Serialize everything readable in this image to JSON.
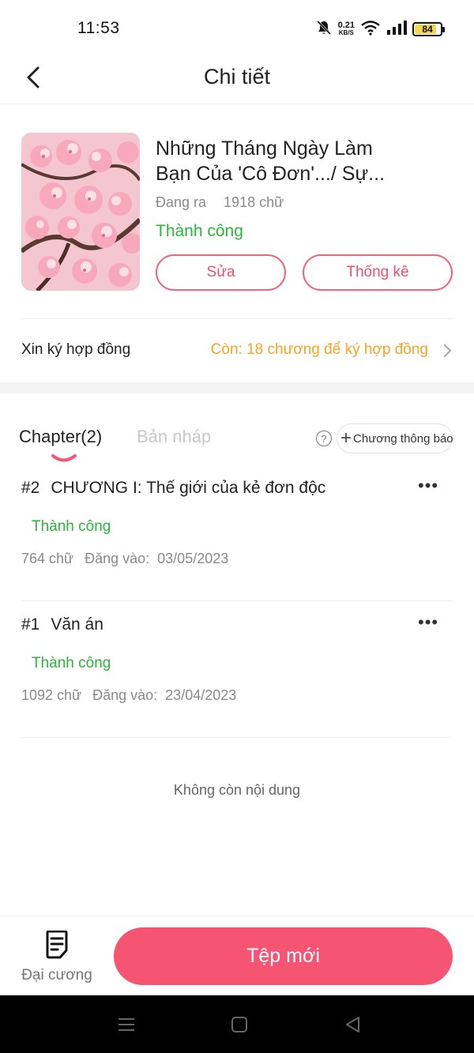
{
  "status_bar": {
    "time": "11:53",
    "net_speed": "0.21",
    "net_unit": "KB/S",
    "battery": "84",
    "battery_fraction": 0.84
  },
  "header": {
    "title": "Chi tiết",
    "back_icon": "chevron-left-icon"
  },
  "book": {
    "title_line1": "Những Tháng Ngày Làm",
    "title_line2": "Bạn Của 'Cô Đơn'.../ Sự...",
    "state": "Đang ra",
    "word_count": "1918 chữ",
    "status": "Thành công",
    "edit_label": "Sửa",
    "stats_label": "Thống kê"
  },
  "contract": {
    "label": "Xin ký hợp đồng",
    "value": "Còn: 18 chương để ký hợp đồng"
  },
  "tabs": {
    "chapter": "Chapter(2)",
    "draft": "Bản nháp",
    "help": "?",
    "notice_plus": "+",
    "notice_label": "Chương thông báo"
  },
  "chapters": [
    {
      "number": "#2",
      "title": "CHƯƠNG I: Thế giới của kẻ đơn độc",
      "status": "Thành công",
      "words": "764 chữ",
      "posted_label": "Đăng vào:",
      "date": "03/05/2023"
    },
    {
      "number": "#1",
      "title": "Văn án",
      "status": "Thành công",
      "words": "1092 chữ",
      "posted_label": "Đăng vào:",
      "date": "23/04/2023"
    }
  ],
  "list_end": "Không còn nội dung",
  "bottom": {
    "outline_label": "Đại cương",
    "new_label": "Tệp mới"
  },
  "colors": {
    "accent": "#f55572",
    "success": "#2bb53b",
    "warning": "#f5a522"
  }
}
